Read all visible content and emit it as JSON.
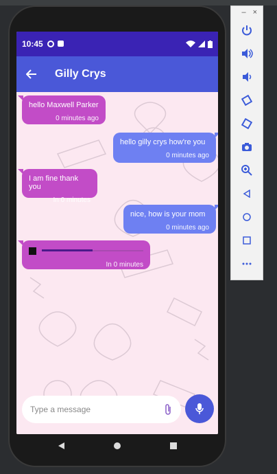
{
  "chat": {
    "contact_name": "Gilly Crys",
    "messages": [
      {
        "direction": "in",
        "text": "hello Maxwell Parker",
        "time": "0 minutes ago"
      },
      {
        "direction": "out",
        "text": "hello gilly crys how're you",
        "time": "0 minutes ago"
      },
      {
        "direction": "in",
        "text": "I am fine thank you",
        "time": "In 0 minutes"
      },
      {
        "direction": "out",
        "text": "nice, how is your mom",
        "time": "0 minutes ago"
      },
      {
        "direction": "in",
        "type": "audio",
        "progress": 0.5,
        "time": "In 0 minutes"
      }
    ]
  },
  "status_bar": {
    "time": "10:45"
  },
  "composer": {
    "placeholder": "Type a message"
  },
  "colors": {
    "status_bar": "#3a23b4",
    "app_bar": "#4a58d8",
    "incoming_bubble": "#c24cc7",
    "outgoing_bubble": "#6e80f2",
    "chat_background": "#fce8f1"
  },
  "icons": {
    "back": "arrow-left-icon",
    "attach": "paperclip-icon",
    "mic": "microphone-icon",
    "nav_back": "triangle-back-icon",
    "nav_home": "circle-home-icon",
    "nav_recents": "square-recents-icon"
  },
  "emulator_panel": {
    "window_controls": [
      "–",
      "×"
    ],
    "buttons": [
      "power",
      "volume-up",
      "volume-down",
      "rotate-left",
      "rotate-right",
      "camera",
      "zoom",
      "back",
      "home",
      "overview",
      "more"
    ]
  }
}
